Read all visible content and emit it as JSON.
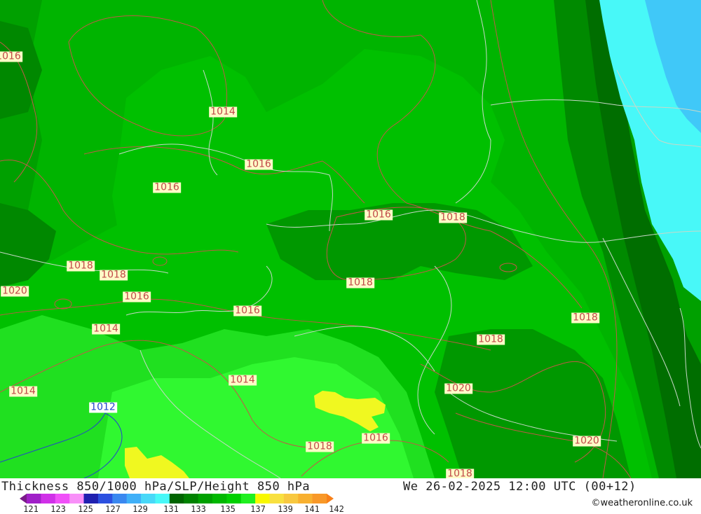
{
  "title": "Thickness 850/1000 hPa/SLP/Height 850 hPa",
  "datetime": "We 26-02-2025 12:00 UTC (00+12)",
  "credit": "©weatheronline.co.uk",
  "legend": {
    "ticks": [
      "121",
      "123",
      "125",
      "127",
      "129",
      "131",
      "133",
      "135",
      "137",
      "139",
      "141",
      "142"
    ],
    "colors": [
      "#7a1a8a",
      "#a020c8",
      "#d030e8",
      "#f050f8",
      "#f890f8",
      "#2020b0",
      "#2c50e0",
      "#3a88f0",
      "#40b0f8",
      "#48d8f8",
      "#48f8f8",
      "#006400",
      "#008200",
      "#00a000",
      "#00b800",
      "#00d000",
      "#20f020",
      "#f8f800",
      "#f8e040",
      "#f8c840",
      "#f8b030",
      "#f89828",
      "#f88018"
    ]
  },
  "pressure_labels": {
    "p0": "1016",
    "p1": "1014",
    "p2": "1016",
    "p3": "1016",
    "p4": "1016",
    "p5": "1018",
    "p6": "1018",
    "p7": "1018",
    "p8": "1020",
    "p9": "1016",
    "p10": "1018",
    "p11": "1016",
    "p12": "1014",
    "p13": "1018",
    "p14": "1018",
    "p15": "1014",
    "p16": "1014",
    "p17": "1020",
    "p18": "1012",
    "p19": "1016",
    "p20": "1018",
    "p21": "1020",
    "p22": "1018"
  }
}
